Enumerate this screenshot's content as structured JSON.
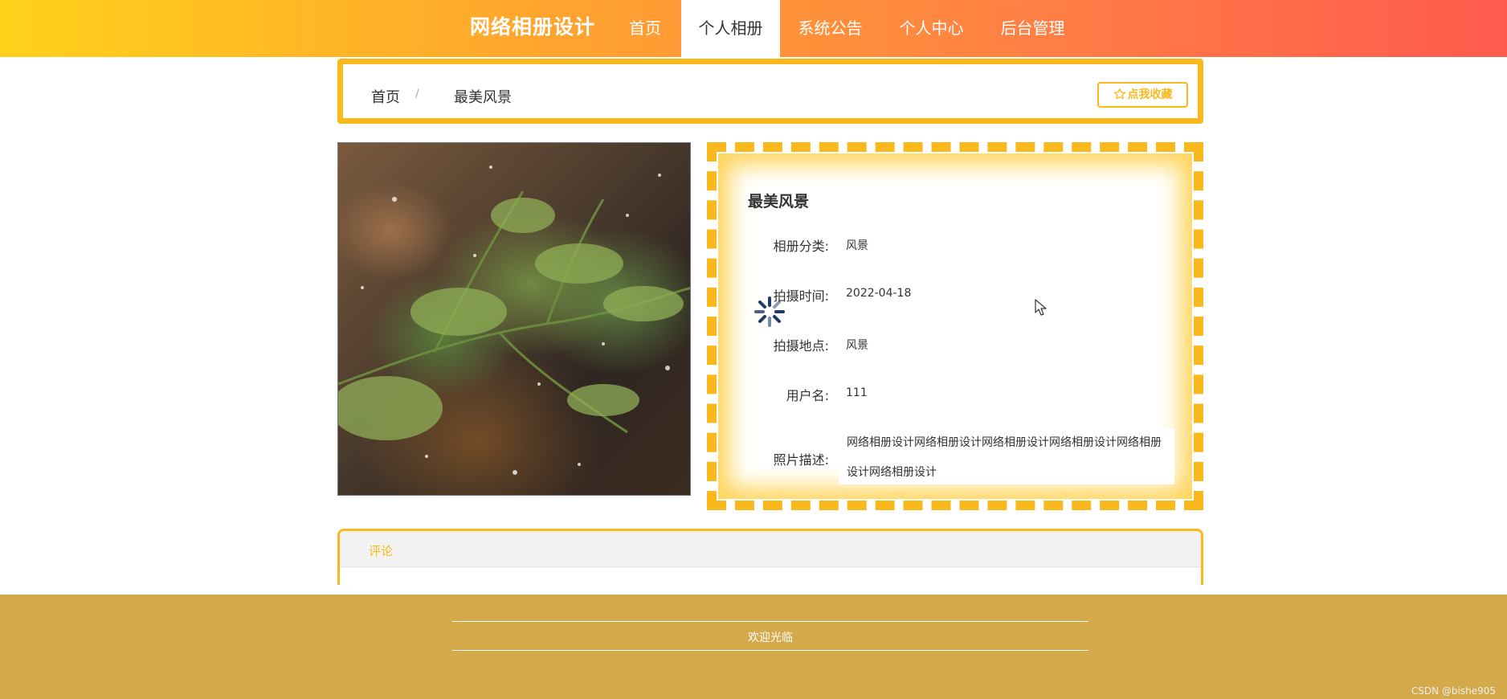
{
  "site": {
    "brand": "网络相册设计"
  },
  "nav": [
    {
      "label": "首页",
      "active": false
    },
    {
      "label": "个人相册",
      "active": true
    },
    {
      "label": "系统公告",
      "active": false
    },
    {
      "label": "个人中心",
      "active": false
    },
    {
      "label": "后台管理",
      "active": false
    }
  ],
  "breadcrumb": {
    "home": "首页",
    "separator": "/",
    "current": "最美风景"
  },
  "favorite_button": {
    "label": "点我收藏",
    "icon": "star-outline-icon"
  },
  "photo": {
    "alt": "最美风景"
  },
  "detail": {
    "title": "最美风景",
    "fields": [
      {
        "label": "相册分类:",
        "value": "风景"
      },
      {
        "label": "拍摄时间:",
        "value": "2022-04-18"
      },
      {
        "label": "拍摄地点:",
        "value": "风景"
      },
      {
        "label": "用户名:",
        "value": "111"
      }
    ],
    "description_label": "照片描述:",
    "description": "网络相册设计网络相册设计网络相册设计网络相册设计网络相册设计网络相册设计"
  },
  "comments": {
    "title": "评论"
  },
  "footer": {
    "text": "欢迎光临",
    "watermark": "CSDN @bishe905"
  },
  "colors": {
    "accent": "#f9b81c",
    "footer_bg": "#d4a94a",
    "nav_gradient_start": "#ffd11a",
    "nav_gradient_end": "#ff5a4e"
  }
}
